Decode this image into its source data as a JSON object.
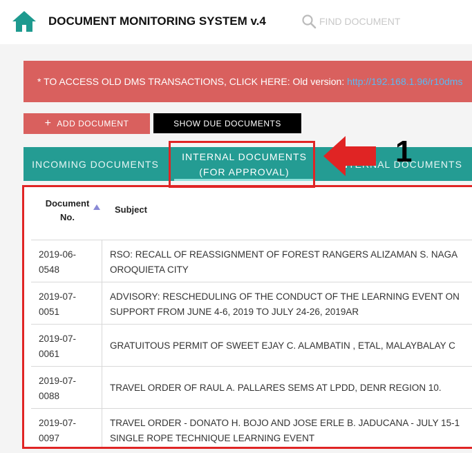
{
  "header": {
    "title": "DOCUMENT MONITORING SYSTEM v.4",
    "search_placeholder": "FIND DOCUMENT",
    "icons": {
      "home": "home-icon",
      "search": "search-icon"
    }
  },
  "alert": {
    "text": "* TO ACCESS OLD DMS TRANSACTIONS, CLICK HERE: Old version: ",
    "link": "http://192.168.1.96/r10dms"
  },
  "buttons": {
    "add_label": "ADD DOCUMENT",
    "add_icon": "plus-icon",
    "due_label": "SHOW DUE DOCUMENTS"
  },
  "tabs": [
    {
      "line1": "INCOMING DOCUMENTS",
      "line2": ""
    },
    {
      "line1": "INTERNAL DOCUMENTS",
      "line2": "(FOR APPROVAL)"
    },
    {
      "line1": "INTERNAL DOCUMENTS",
      "line2": ""
    }
  ],
  "annotation": {
    "step": "1",
    "color": "#e02424"
  },
  "table": {
    "headers": {
      "doc_no_1": "Document",
      "doc_no_2": "No.",
      "subject": "Subject"
    },
    "rows": [
      {
        "doc_no_1": "2019-06-",
        "doc_no_2": "0548",
        "subject_1": "RSO: RECALL OF REASSIGNMENT OF FOREST RANGERS ALIZAMAN S. NAGA",
        "subject_2": "OROQUIETA CITY"
      },
      {
        "doc_no_1": "2019-07-",
        "doc_no_2": "0051",
        "subject_1": "ADVISORY: RESCHEDULING OF THE CONDUCT OF THE LEARNING EVENT ON",
        "subject_2": "SUPPORT FROM JUNE 4-6, 2019 TO JULY 24-26, 2019AR"
      },
      {
        "doc_no_1": "2019-07-",
        "doc_no_2": "0061",
        "subject_1": "GRATUITOUS PERMIT OF SWEET EJAY C. ALAMBATIN , ETAL, MALAYBALAY C",
        "subject_2": ""
      },
      {
        "doc_no_1": "2019-07-",
        "doc_no_2": "0088",
        "subject_1": "TRAVEL ORDER OF RAUL A. PALLARES SEMS AT LPDD, DENR REGION 10.",
        "subject_2": ""
      },
      {
        "doc_no_1": "2019-07-",
        "doc_no_2": "0097",
        "subject_1": "TRAVEL ORDER - DONATO H. BOJO AND JOSE ERLE B. JADUCANA - JULY 15-1",
        "subject_2": "SINGLE ROPE TECHNIQUE LEARNING EVENT"
      }
    ]
  },
  "colors": {
    "teal": "#249c93",
    "alert": "#d9605e",
    "annotation": "#e02424"
  }
}
